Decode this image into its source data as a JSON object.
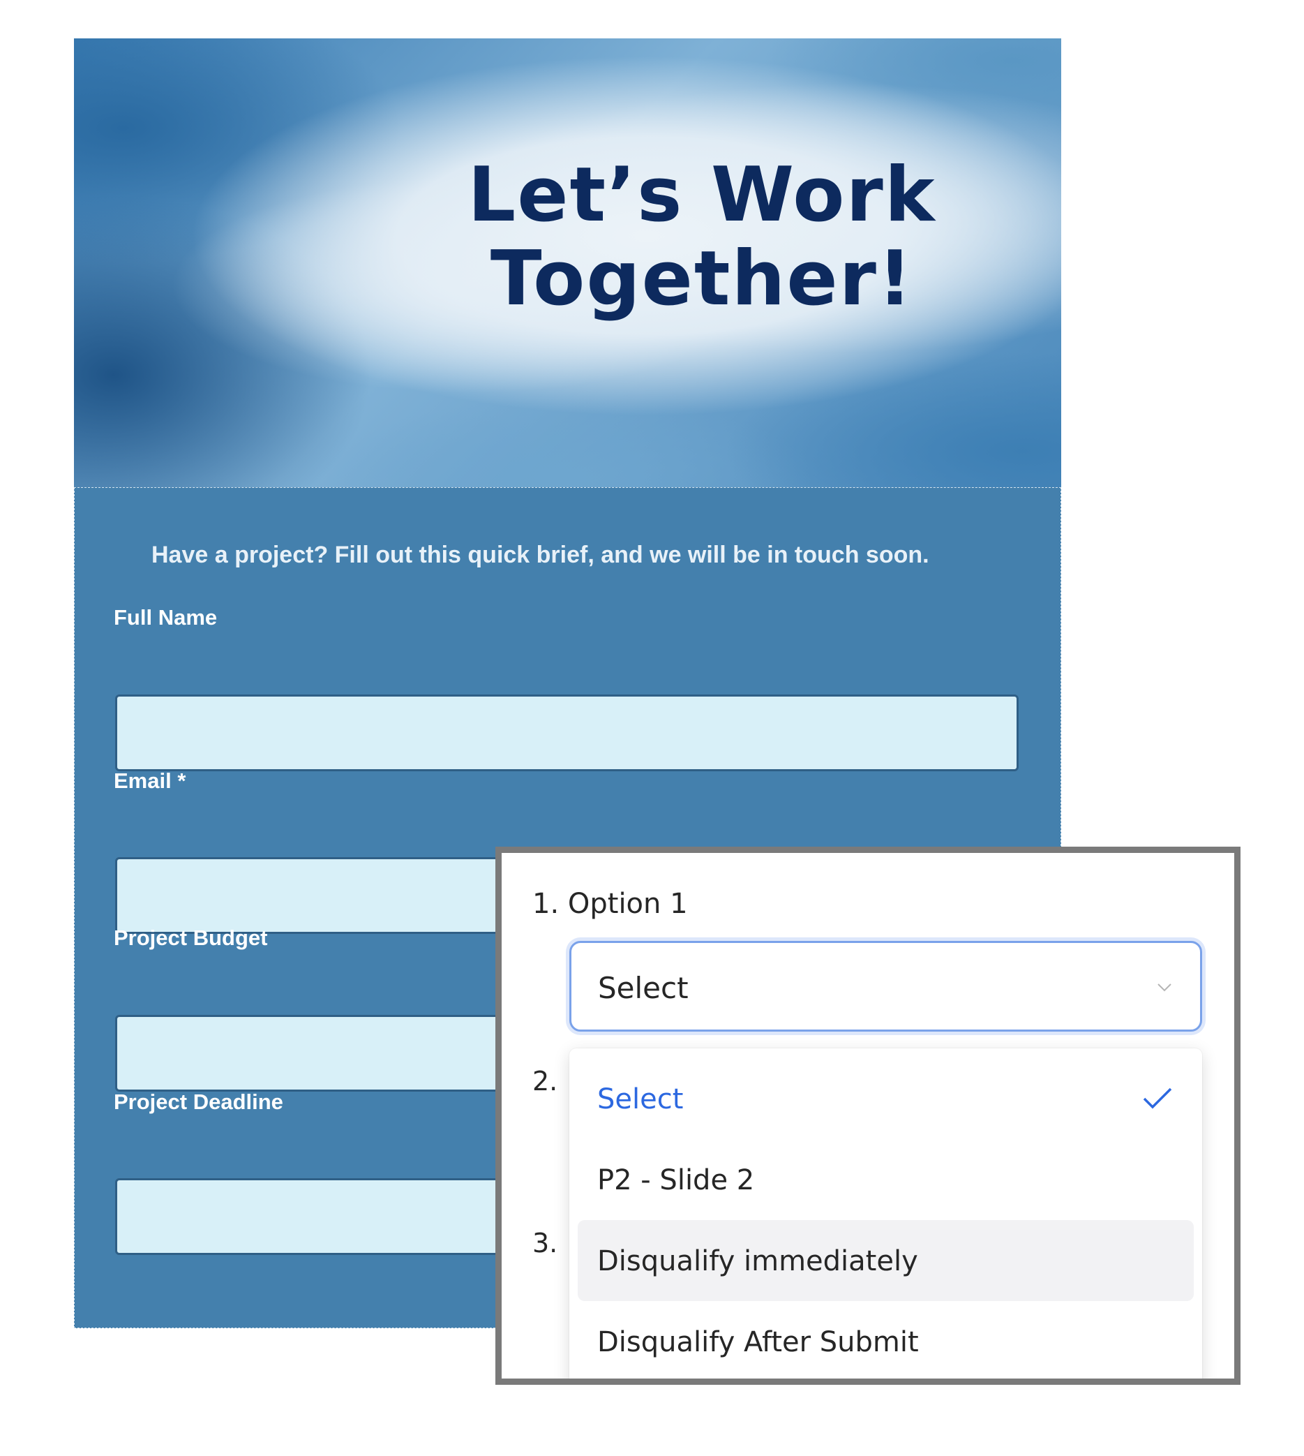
{
  "banner": {
    "title_line1": "Let’s Work",
    "title_line2": "Together!"
  },
  "form": {
    "intro_text": "Have a project? Fill out this quick brief, and we will be in touch soon.",
    "fields": [
      {
        "label": "Full Name",
        "value": ""
      },
      {
        "label": "Email *",
        "value": ""
      },
      {
        "label": "Project Budget",
        "value": ""
      },
      {
        "label": "Project Deadline",
        "value": ""
      }
    ]
  },
  "dropdown_panel": {
    "question_label": "1. Option 1",
    "select_value": "Select",
    "number_labels": [
      "2.",
      "3."
    ],
    "options": [
      {
        "label": "Select",
        "selected": true
      },
      {
        "label": "P2 - Slide 2",
        "selected": false
      },
      {
        "label": "Disqualify immediately",
        "selected": false,
        "hovered": true
      },
      {
        "label": "Disqualify After Submit",
        "selected": false
      }
    ]
  },
  "colors": {
    "form_background": "#4480ad",
    "input_background": "#d8f0f8",
    "title_color": "#0d2a5e",
    "selected_option": "#2c68e0",
    "overlay_border": "#7a7a7a"
  },
  "icons": {
    "select_chevron": "chevron-down-icon",
    "selected_check": "check-icon"
  }
}
